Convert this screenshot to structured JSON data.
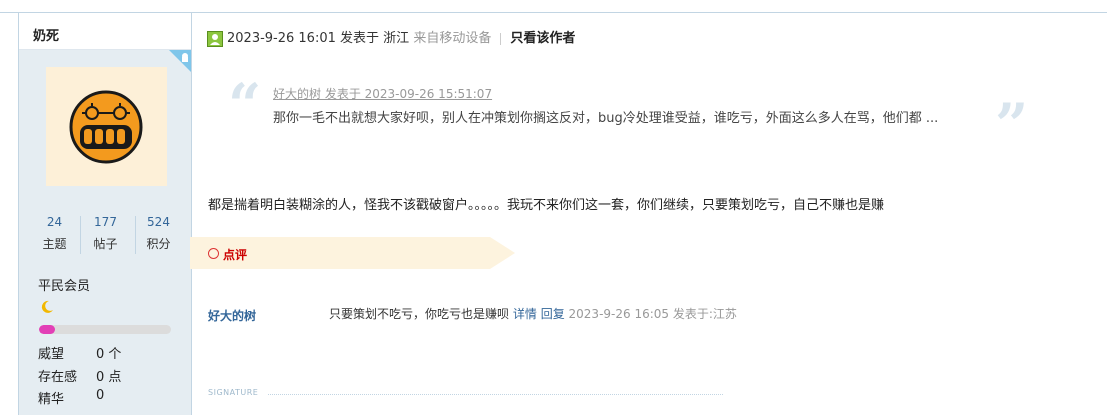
{
  "sidebar": {
    "username": "奶死",
    "stats": [
      {
        "value": "24",
        "label": "主题"
      },
      {
        "value": "177",
        "label": "帖子"
      },
      {
        "value": "524",
        "label": "积分"
      }
    ],
    "rank": "平民会员",
    "progress": 0.12,
    "info": [
      {
        "label": "威望",
        "value": "0 个"
      },
      {
        "label": "存在感",
        "value": "0 点"
      },
      {
        "label": "精华",
        "value": "0"
      }
    ]
  },
  "post": {
    "time": "2023-9-26 16:01",
    "posted_at": "发表于",
    "location": "浙江",
    "device": "来自移动设备",
    "author_only": "只看该作者",
    "quote": {
      "meta": "好大的树 发表于 2023-09-26 15:51:07",
      "text": "那你一毛不出就想大家好呗，别人在冲策划你搁这反对，bug冷处理谁受益，谁吃亏，外面这么多人在骂，他们都 ..."
    },
    "body": "都是揣着明白装糊涂的人，怪我不该戳破窗户。。。。。我玩不来你们这一套，你们继续，只要策划吃亏，自己不赚也是赚",
    "comment_section_label": "点评",
    "comment": {
      "author": "好大的树",
      "text": "只要策划不吃亏，你吃亏也是赚呗",
      "detail": "详情",
      "reply": "回复",
      "meta": "2023-9-26 16:05 发表于:江苏"
    },
    "signature_label": "SIGNATURE"
  }
}
